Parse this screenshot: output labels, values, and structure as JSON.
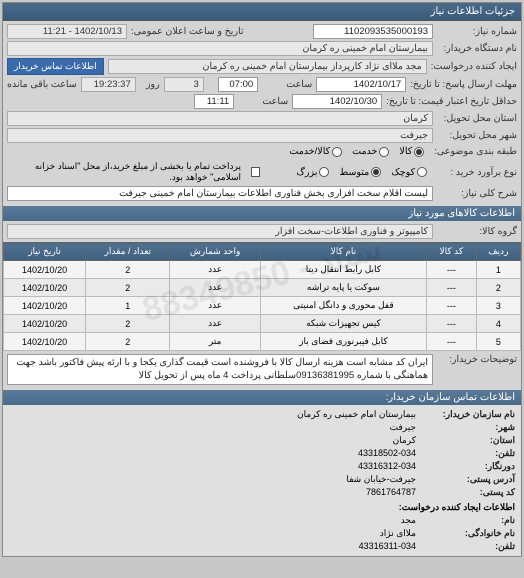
{
  "header": {
    "title": "جزئیات اطلاعات نیاز"
  },
  "fields": {
    "req_no_label": "شماره نیاز:",
    "req_no": "1102093535000193",
    "public_time_label": "تاریخ و ساعت اعلان عمومی:",
    "public_time": "1402/10/13 - 11:21",
    "buyer_org_label": "نام دستگاه خریدار:",
    "buyer_org": "بیمارستان امام خمینی  ره  کرمان",
    "requester_label": "ایجاد کننده درخواست:",
    "requester": "مجد  ملاای نژاد کارپرداز بیمارستان امام خمینی  ره  کرمان",
    "contact_btn": "اطلاعات تماس خریدار",
    "deadline_label": "مهلت ارسال پاسخ: تا تاریخ:",
    "deadline_date": "1402/10/17",
    "hour_label": "ساعت",
    "deadline_time": "07:00",
    "remain_day_label": "روز",
    "remain_days": "3",
    "remain_time": "19:23:37",
    "remain_label": "ساعت باقی مانده",
    "validity_label": "حداقل تاریخ اعتبار قیمت: تا تاریخ:",
    "validity_date": "1402/10/30",
    "validity_time": "11:11",
    "delivery_state_label": "استان محل تحویل:",
    "delivery_state": "کرمان",
    "delivery_city_label": "شهر محل تحویل:",
    "delivery_city": "جیرفت",
    "subject_cat_label": "طبقه بندی موضوعی:",
    "r_goods": "کالا",
    "r_service": "خدمت",
    "r_lease": "کالا/خدمت",
    "purchase_type_label": "نوع برآورد خرید :",
    "r_small": "کوچک",
    "r_medium": "متوسط",
    "r_large": "بزرگ",
    "note_text": "پرداخت تمام یا بخشی از مبلغ خرید،از محل \"اسناد خزانه اسلامی\" خواهد بود.",
    "desc_label": "شرح کلی نیاز:",
    "desc": "لیست اقلام سخت افزاری بخش فناوری اطلاعات بیمارستان امام خمینی جیرفت"
  },
  "goods_header": "اطلاعات کالاهای مورد نیاز",
  "goods_group_label": "گروه کالا:",
  "goods_group": "کامپیوتر و فناوری اطلاعات-سخت افزار",
  "table": {
    "headers": [
      "ردیف",
      "کد کالا",
      "نام کالا",
      "واحد شمارش",
      "تعداد / مقدار",
      "تاریخ نیاز"
    ],
    "rows": [
      [
        "1",
        "---",
        "کابل رابط انتقال دیتا",
        "عدد",
        "2",
        "1402/10/20"
      ],
      [
        "2",
        "---",
        "سوکت یا پایه تراشه",
        "عدد",
        "2",
        "1402/10/20"
      ],
      [
        "3",
        "---",
        "قفل محوری و دانگل امنیتی",
        "عدد",
        "1",
        "1402/10/20"
      ],
      [
        "4",
        "---",
        "کیس تجهیزات شبکه",
        "عدد",
        "2",
        "1402/10/20"
      ],
      [
        "5",
        "---",
        "کابل فیبرنوری فضای باز",
        "متر",
        "2",
        "1402/10/20"
      ]
    ]
  },
  "explain_label": "توضیحات خریدار:",
  "explain_text": "ایران کد مشابه است هزینه ارسال کالا با فروشنده است قیمت گذاری یکجا و با ارئه پیش فاکتور باشد جهت هماهنگی با شماره 09136381995سلطانی پرداخت 4 ماه پس از تحویل کالا",
  "contact": {
    "header": "اطلاعات تماس سازمان خریدار:",
    "org_label": "نام سازمان خریدار:",
    "org": "بیمارستان امام خمینی ره کرمان",
    "city_label": "شهر:",
    "city": "جیرفت",
    "state_label": "استان:",
    "state": "کرمان",
    "tel_label": "تلفن:",
    "tel": "43318502-034",
    "fax_label": "دورنگار:",
    "fax": "43316312-034",
    "addr_label": "آدرس پستی:",
    "addr": "جیرفت-خیابان شفا",
    "post_label": "کد پستی:",
    "post": "7861764787",
    "creator_header": "اطلاعات ایجاد کننده درخواست:",
    "fname_label": "نام:",
    "fname": "مجد",
    "lname_label": "نام خانوادگی:",
    "lname": "ملاای نژاد",
    "ctel_label": "تلفن:",
    "ctel": "43316311-034"
  },
  "watermark": "ستاد - 88349850"
}
